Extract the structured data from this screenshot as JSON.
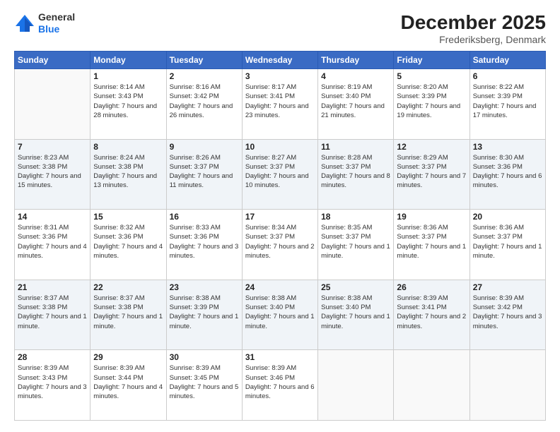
{
  "header": {
    "logo_general": "General",
    "logo_blue": "Blue",
    "month": "December 2025",
    "location": "Frederiksberg, Denmark"
  },
  "days_of_week": [
    "Sunday",
    "Monday",
    "Tuesday",
    "Wednesday",
    "Thursday",
    "Friday",
    "Saturday"
  ],
  "weeks": [
    [
      {
        "day": "",
        "sunrise": "",
        "sunset": "",
        "daylight": ""
      },
      {
        "day": "1",
        "sunrise": "Sunrise: 8:14 AM",
        "sunset": "Sunset: 3:43 PM",
        "daylight": "Daylight: 7 hours and 28 minutes."
      },
      {
        "day": "2",
        "sunrise": "Sunrise: 8:16 AM",
        "sunset": "Sunset: 3:42 PM",
        "daylight": "Daylight: 7 hours and 26 minutes."
      },
      {
        "day": "3",
        "sunrise": "Sunrise: 8:17 AM",
        "sunset": "Sunset: 3:41 PM",
        "daylight": "Daylight: 7 hours and 23 minutes."
      },
      {
        "day": "4",
        "sunrise": "Sunrise: 8:19 AM",
        "sunset": "Sunset: 3:40 PM",
        "daylight": "Daylight: 7 hours and 21 minutes."
      },
      {
        "day": "5",
        "sunrise": "Sunrise: 8:20 AM",
        "sunset": "Sunset: 3:39 PM",
        "daylight": "Daylight: 7 hours and 19 minutes."
      },
      {
        "day": "6",
        "sunrise": "Sunrise: 8:22 AM",
        "sunset": "Sunset: 3:39 PM",
        "daylight": "Daylight: 7 hours and 17 minutes."
      }
    ],
    [
      {
        "day": "7",
        "sunrise": "Sunrise: 8:23 AM",
        "sunset": "Sunset: 3:38 PM",
        "daylight": "Daylight: 7 hours and 15 minutes."
      },
      {
        "day": "8",
        "sunrise": "Sunrise: 8:24 AM",
        "sunset": "Sunset: 3:38 PM",
        "daylight": "Daylight: 7 hours and 13 minutes."
      },
      {
        "day": "9",
        "sunrise": "Sunrise: 8:26 AM",
        "sunset": "Sunset: 3:37 PM",
        "daylight": "Daylight: 7 hours and 11 minutes."
      },
      {
        "day": "10",
        "sunrise": "Sunrise: 8:27 AM",
        "sunset": "Sunset: 3:37 PM",
        "daylight": "Daylight: 7 hours and 10 minutes."
      },
      {
        "day": "11",
        "sunrise": "Sunrise: 8:28 AM",
        "sunset": "Sunset: 3:37 PM",
        "daylight": "Daylight: 7 hours and 8 minutes."
      },
      {
        "day": "12",
        "sunrise": "Sunrise: 8:29 AM",
        "sunset": "Sunset: 3:37 PM",
        "daylight": "Daylight: 7 hours and 7 minutes."
      },
      {
        "day": "13",
        "sunrise": "Sunrise: 8:30 AM",
        "sunset": "Sunset: 3:36 PM",
        "daylight": "Daylight: 7 hours and 6 minutes."
      }
    ],
    [
      {
        "day": "14",
        "sunrise": "Sunrise: 8:31 AM",
        "sunset": "Sunset: 3:36 PM",
        "daylight": "Daylight: 7 hours and 4 minutes."
      },
      {
        "day": "15",
        "sunrise": "Sunrise: 8:32 AM",
        "sunset": "Sunset: 3:36 PM",
        "daylight": "Daylight: 7 hours and 4 minutes."
      },
      {
        "day": "16",
        "sunrise": "Sunrise: 8:33 AM",
        "sunset": "Sunset: 3:36 PM",
        "daylight": "Daylight: 7 hours and 3 minutes."
      },
      {
        "day": "17",
        "sunrise": "Sunrise: 8:34 AM",
        "sunset": "Sunset: 3:37 PM",
        "daylight": "Daylight: 7 hours and 2 minutes."
      },
      {
        "day": "18",
        "sunrise": "Sunrise: 8:35 AM",
        "sunset": "Sunset: 3:37 PM",
        "daylight": "Daylight: 7 hours and 1 minute."
      },
      {
        "day": "19",
        "sunrise": "Sunrise: 8:36 AM",
        "sunset": "Sunset: 3:37 PM",
        "daylight": "Daylight: 7 hours and 1 minute."
      },
      {
        "day": "20",
        "sunrise": "Sunrise: 8:36 AM",
        "sunset": "Sunset: 3:37 PM",
        "daylight": "Daylight: 7 hours and 1 minute."
      }
    ],
    [
      {
        "day": "21",
        "sunrise": "Sunrise: 8:37 AM",
        "sunset": "Sunset: 3:38 PM",
        "daylight": "Daylight: 7 hours and 1 minute."
      },
      {
        "day": "22",
        "sunrise": "Sunrise: 8:37 AM",
        "sunset": "Sunset: 3:38 PM",
        "daylight": "Daylight: 7 hours and 1 minute."
      },
      {
        "day": "23",
        "sunrise": "Sunrise: 8:38 AM",
        "sunset": "Sunset: 3:39 PM",
        "daylight": "Daylight: 7 hours and 1 minute."
      },
      {
        "day": "24",
        "sunrise": "Sunrise: 8:38 AM",
        "sunset": "Sunset: 3:40 PM",
        "daylight": "Daylight: 7 hours and 1 minute."
      },
      {
        "day": "25",
        "sunrise": "Sunrise: 8:38 AM",
        "sunset": "Sunset: 3:40 PM",
        "daylight": "Daylight: 7 hours and 1 minute."
      },
      {
        "day": "26",
        "sunrise": "Sunrise: 8:39 AM",
        "sunset": "Sunset: 3:41 PM",
        "daylight": "Daylight: 7 hours and 2 minutes."
      },
      {
        "day": "27",
        "sunrise": "Sunrise: 8:39 AM",
        "sunset": "Sunset: 3:42 PM",
        "daylight": "Daylight: 7 hours and 3 minutes."
      }
    ],
    [
      {
        "day": "28",
        "sunrise": "Sunrise: 8:39 AM",
        "sunset": "Sunset: 3:43 PM",
        "daylight": "Daylight: 7 hours and 3 minutes."
      },
      {
        "day": "29",
        "sunrise": "Sunrise: 8:39 AM",
        "sunset": "Sunset: 3:44 PM",
        "daylight": "Daylight: 7 hours and 4 minutes."
      },
      {
        "day": "30",
        "sunrise": "Sunrise: 8:39 AM",
        "sunset": "Sunset: 3:45 PM",
        "daylight": "Daylight: 7 hours and 5 minutes."
      },
      {
        "day": "31",
        "sunrise": "Sunrise: 8:39 AM",
        "sunset": "Sunset: 3:46 PM",
        "daylight": "Daylight: 7 hours and 6 minutes."
      },
      {
        "day": "",
        "sunrise": "",
        "sunset": "",
        "daylight": ""
      },
      {
        "day": "",
        "sunrise": "",
        "sunset": "",
        "daylight": ""
      },
      {
        "day": "",
        "sunrise": "",
        "sunset": "",
        "daylight": ""
      }
    ]
  ]
}
